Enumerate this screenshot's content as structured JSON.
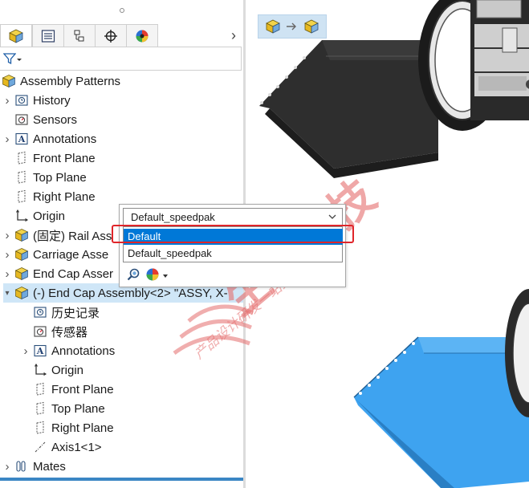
{
  "tabs": [
    {
      "name": "feature-manager",
      "icon": "assembly-icon",
      "active": true
    },
    {
      "name": "property-manager",
      "icon": "list-icon",
      "active": false
    },
    {
      "name": "configuration-manager",
      "icon": "configuration-icon",
      "active": false
    },
    {
      "name": "dimxpert-manager",
      "icon": "crosshair-icon",
      "active": false
    },
    {
      "name": "display-manager",
      "icon": "appearance-icon",
      "active": false
    }
  ],
  "tree": {
    "root": "Assembly Patterns",
    "items": [
      {
        "label": "History",
        "icon": "history-icon",
        "expandable": true
      },
      {
        "label": "Sensors",
        "icon": "sensor-icon",
        "expandable": false
      },
      {
        "label": "Annotations",
        "icon": "annotation-icon",
        "expandable": true
      },
      {
        "label": "Front Plane",
        "icon": "plane-icon",
        "expandable": false
      },
      {
        "label": "Top Plane",
        "icon": "plane-icon",
        "expandable": false
      },
      {
        "label": "Right Plane",
        "icon": "plane-icon",
        "expandable": false
      },
      {
        "label": "Origin",
        "icon": "origin-icon",
        "expandable": false
      },
      {
        "label": "(固定) Rail Ass",
        "icon": "part-icon",
        "expandable": true
      },
      {
        "label": "Carriage Asse",
        "icon": "part-icon",
        "expandable": true
      },
      {
        "label": "End Cap Asser",
        "icon": "part-icon",
        "expandable": true
      },
      {
        "label": "(-) End Cap Assembly<2> \"ASSY, X-",
        "icon": "part-icon",
        "expandable": true,
        "expanded": true,
        "selected": true
      }
    ],
    "children": [
      {
        "label": "历史记录",
        "icon": "history-icon",
        "expandable": false
      },
      {
        "label": "传感器",
        "icon": "sensor-icon",
        "expandable": false
      },
      {
        "label": "Annotations",
        "icon": "annotation-icon",
        "expandable": true
      },
      {
        "label": "Origin",
        "icon": "origin-icon",
        "expandable": false
      },
      {
        "label": "Front Plane",
        "icon": "plane-icon",
        "expandable": false
      },
      {
        "label": "Top Plane",
        "icon": "plane-icon",
        "expandable": false
      },
      {
        "label": "Right Plane",
        "icon": "plane-icon",
        "expandable": false
      },
      {
        "label": "Axis1<1>",
        "icon": "axis-icon",
        "expandable": false
      }
    ],
    "mates": "Mates"
  },
  "config_popup": {
    "selected": "Default_speedpak",
    "options": [
      "Default",
      "Default_speedpak"
    ],
    "highlighted_index": 0
  },
  "watermark": {
    "title": "生信科技",
    "subtitle": "产品设计研发一站式解决方案"
  },
  "colors": {
    "accent": "#0078d7",
    "selection": "#cfe6f7",
    "highlight_box": "#e0252a",
    "model_blue": "#3ea3f0",
    "model_dark": "#2e2e2e"
  }
}
